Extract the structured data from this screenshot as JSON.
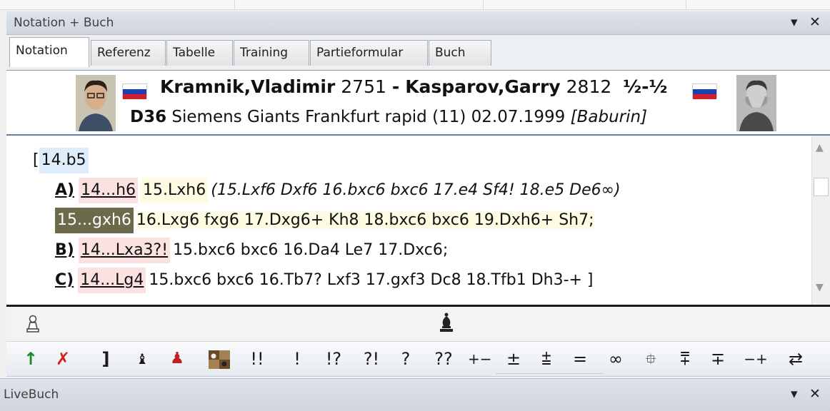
{
  "panel": {
    "title": "Notation + Buch",
    "pin_glyph": "▾",
    "close_glyph": "✕"
  },
  "tabs": [
    {
      "label": "Notation",
      "active": true
    },
    {
      "label": "Referenz",
      "active": false
    },
    {
      "label": "Tabelle",
      "active": false
    },
    {
      "label": "Training",
      "active": false
    },
    {
      "label": "Partieformular",
      "active": false
    },
    {
      "label": "Buch",
      "active": false
    }
  ],
  "game": {
    "white_name": "Kramnik,Vladimir",
    "white_elo": "2751",
    "separator": "-",
    "black_name": "Kasparov,Garry",
    "black_elo": "2812",
    "result": "½-½",
    "eco": "D36",
    "event": "Siemens Giants Frankfurt rapid (11) 02.07.1999",
    "annotator": "[Baburin]",
    "white_flag": "russia",
    "black_flag": "russia"
  },
  "notation": {
    "open_bracket": "[",
    "main_move": "14.b5",
    "var_a_label": "A)",
    "var_a_move": "14...h6",
    "var_a_cont": "15.Lxh6",
    "var_a_sub": "(15.Lxf6  Dxf6  16.bxc6  bxc6  17.e4  Sf4!  18.e5  De6∞)",
    "var_a_line2_move": "15...gxh6",
    "var_a_line2_cont": "16.Lxg6  fxg6  17.Dxg6+  Kh8  18.bxc6  bxc6  19.Dxh6+  Sh7;",
    "var_b_label": "B)",
    "var_b_move": "14...Lxa3?!",
    "var_b_cont": "15.bxc6  bxc6  16.Da4  Le7  17.Dxc6;",
    "var_c_label": "C)",
    "var_c_move": "14...Lg4",
    "var_c_cont": "15.bxc6  bxc6  16.Tb7?  Lxf3  17.gxf3  Dc8  18.Tfb1  Dh3-+ ]"
  },
  "toolbar": {
    "symbols": [
      "!!",
      "!",
      "!?",
      "?!",
      "?",
      "??",
      "+−",
      "±",
      "⩲",
      "=",
      "∞",
      "⯐",
      "⩱",
      "∓",
      "−+",
      "⇄"
    ]
  },
  "livebuch": {
    "title": "LiveBuch"
  },
  "colors": {
    "move_highlight_blue": "#deedfb",
    "move_highlight_pink": "#fbe2e0",
    "line_highlight_yellow": "#fdfbe2",
    "current_move_dark": "#6b6b4b",
    "arrow_green": "#1e8a2e",
    "cross_red": "#d02020"
  }
}
